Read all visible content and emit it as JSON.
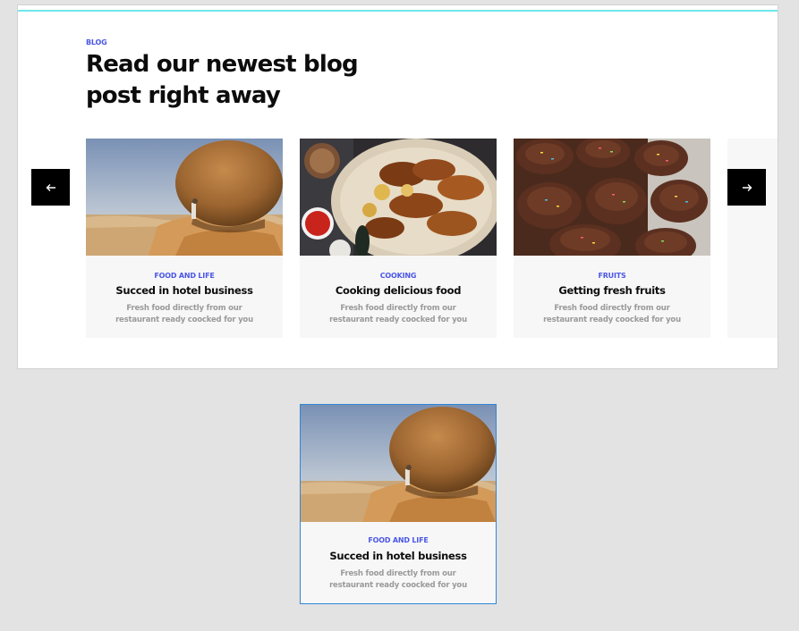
{
  "blog_section": {
    "eyebrow": "BLOG",
    "headline_line1": "Read our newest blog",
    "headline_line2": "post right away",
    "accent_color": "#4b57e6",
    "top_line_color": "#6fe8ea"
  },
  "carousel": {
    "prev_icon": "arrow-left-icon",
    "next_icon": "arrow-right-icon"
  },
  "cards": [
    {
      "image": "boulder-desert-photo",
      "category": "FOOD AND LIFE",
      "title": "Succed in hotel business",
      "desc_line1": "Fresh food directly from our",
      "desc_line2": "restaurant ready coocked for you"
    },
    {
      "image": "grilled-food-platter-photo",
      "category": "COOKING",
      "title": "Cooking delicious food",
      "desc_line1": "Fresh food directly from our",
      "desc_line2": "restaurant ready coocked for you"
    },
    {
      "image": "chocolate-cupcakes-photo",
      "category": "FRUITS",
      "title": "Getting fresh fruits",
      "desc_line1": "Fresh food directly from our",
      "desc_line2": "restaurant ready coocked for you"
    }
  ],
  "preview_card": {
    "image": "boulder-desert-photo",
    "category": "FOOD AND LIFE",
    "title": "Succed in hotel business",
    "desc_line1": "Fresh food directly from our",
    "desc_line2": "restaurant ready coocked for you",
    "border_color": "#2f86d6"
  }
}
